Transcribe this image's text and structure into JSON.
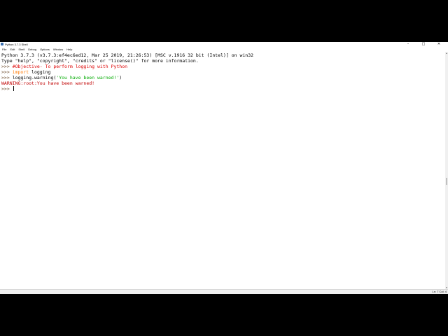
{
  "window": {
    "title": "Python 3.7.3 Shell",
    "minimize_glyph": "–",
    "maximize_glyph": "□",
    "close_glyph": "✕"
  },
  "menu": [
    {
      "label": "File"
    },
    {
      "label": "Edit"
    },
    {
      "label": "Shell"
    },
    {
      "label": "Debug"
    },
    {
      "label": "Options"
    },
    {
      "label": "Window"
    },
    {
      "label": "Help"
    }
  ],
  "shell": {
    "banner_line1": "Python 3.7.3 (v3.7.3:ef4ec6ed12, Mar 25 2019, 21:26:53) [MSC v.1916 32 bit (Intel)] on win32",
    "banner_line2": "Type \"help\", \"copyright\", \"credits\" or \"license()\" for more information.",
    "prompt": ">>> ",
    "line3_comment": "#Objective- To perform logging with Python",
    "line4_keyword": "import",
    "line4_rest": " logging",
    "line5_call": "logging.warning(",
    "line5_string": "'You have been warned!'",
    "line5_close": ")",
    "output_warning": "WARNING:root:You have been warned!"
  },
  "statusbar": {
    "position": "Ln: 7   Col: 4"
  },
  "colors": {
    "prompt": "#6b4a2b",
    "comment": "#dd0000",
    "keyword": "#ff7700",
    "string": "#00aa00",
    "stderr": "#c00000",
    "background": "#ffffff",
    "letterbox": "#000000"
  }
}
